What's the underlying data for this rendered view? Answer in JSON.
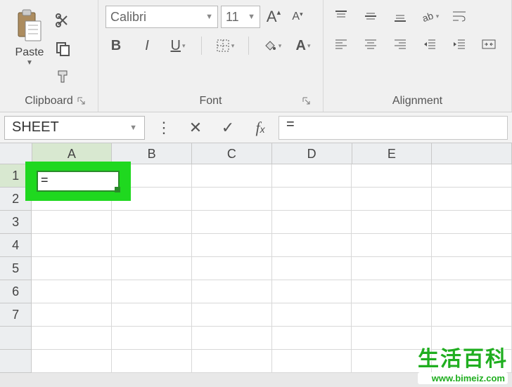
{
  "ribbon": {
    "clipboard": {
      "label": "Clipboard",
      "paste": "Paste"
    },
    "font": {
      "label": "Font",
      "name": "Calibri",
      "size": "11",
      "bold": "B",
      "italic": "I",
      "underline": "U"
    },
    "alignment": {
      "label": "Alignment"
    }
  },
  "namebar": {
    "namebox": "SHEET",
    "formula": "="
  },
  "grid": {
    "columns": [
      "A",
      "B",
      "C",
      "D",
      "E"
    ],
    "rows": [
      "1",
      "2",
      "3",
      "4",
      "5",
      "6",
      "7"
    ],
    "active_cell_value": "="
  },
  "watermark": {
    "logo": "生活百科",
    "url": "www.bimeiz.com"
  }
}
